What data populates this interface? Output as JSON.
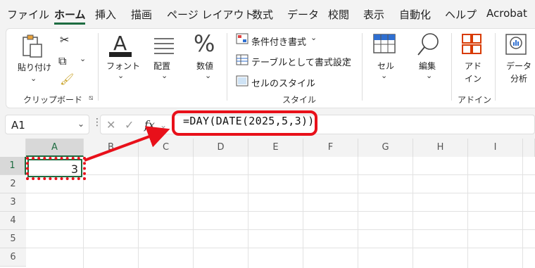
{
  "tabs": [
    "ファイル",
    "ホーム",
    "挿入",
    "描画",
    "ページ レイアウト",
    "数式",
    "データ",
    "校閲",
    "表示",
    "自動化",
    "ヘルプ",
    "Acrobat"
  ],
  "ribbon": {
    "paste": "貼り付け",
    "clipboard_group": "クリップボード",
    "font": "フォント",
    "alignment": "配置",
    "number": "数値",
    "cond_format": "条件付き書式",
    "format_table": "テーブルとして書式設定",
    "cell_style": "セルのスタイル",
    "style_group": "スタイル",
    "cell": "セル",
    "edit": "編集",
    "addin_1": "アド",
    "addin_2": "イン",
    "addin_group": "アドイン",
    "data_1": "データ",
    "data_2": "分析"
  },
  "formula_bar": {
    "name_box": "A1",
    "fx": "fx",
    "formula": "=DAY(DATE(2025,5,3))"
  },
  "sheet": {
    "columns": [
      "A",
      "B",
      "C",
      "D",
      "E",
      "F",
      "G",
      "H",
      "I"
    ],
    "rows": [
      "1",
      "2",
      "3",
      "4",
      "5",
      "6"
    ],
    "A1": "3"
  },
  "colors": {
    "accent": "#1e6c41",
    "annotation": "#e8101a"
  }
}
